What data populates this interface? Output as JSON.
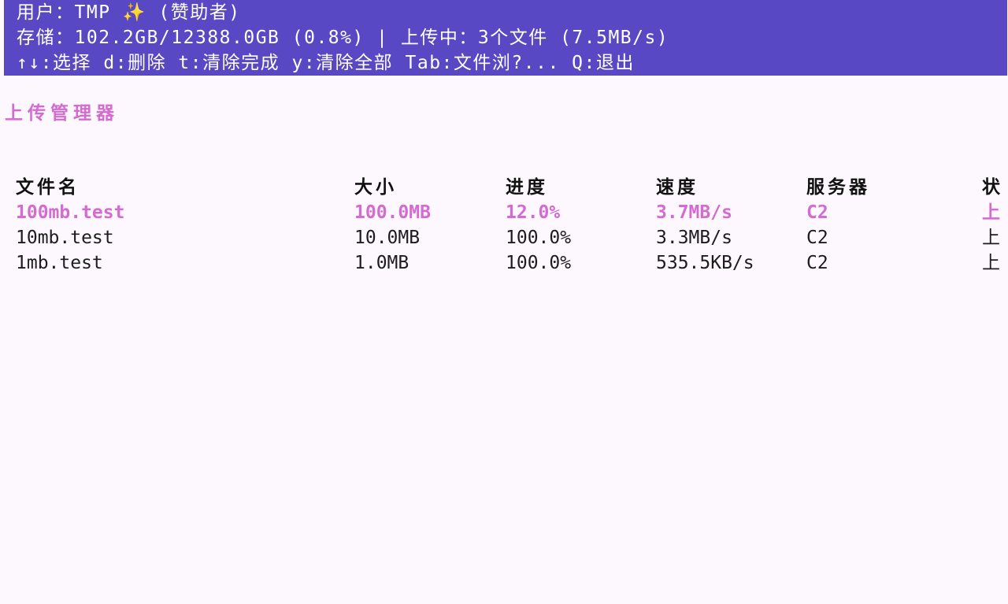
{
  "header": {
    "line1": "用户：TMP ✨ (赞助者)",
    "line2": "存储：102.2GB/12388.0GB (0.8%) | 上传中：3个文件 (7.5MB/s)",
    "line3": "↑↓:选择 d:删除 t:清除完成 y:清除全部 Tab:文件浏?... Q:退出"
  },
  "section_title": "上传管理器",
  "table": {
    "columns": [
      "文件名",
      "大小",
      "进度",
      "速度",
      "服务器",
      "状"
    ],
    "rows": [
      {
        "name": "100mb.test",
        "size": "100.0MB",
        "progress": "12.0%",
        "speed": "3.7MB/s",
        "server": "C2",
        "status": "上"
      },
      {
        "name": "10mb.test",
        "size": "10.0MB",
        "progress": "100.0%",
        "speed": "3.3MB/s",
        "server": "C2",
        "status": "上"
      },
      {
        "name": "1mb.test",
        "size": "1.0MB",
        "progress": "100.0%",
        "speed": "535.5KB/s",
        "server": "C2",
        "status": "上"
      }
    ]
  },
  "colors": {
    "header_bg": "#5848c4",
    "accent": "#d46bd0",
    "background": "#fcf8fd"
  }
}
